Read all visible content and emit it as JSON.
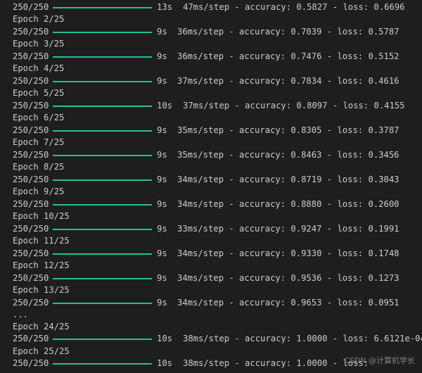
{
  "log": [
    {
      "type": "progress",
      "steps": "250/250",
      "progress": 1.0,
      "time": "13s",
      "metrics": "47ms/step - accuracy: 0.5827 - loss: 0.6696"
    },
    {
      "type": "text",
      "text": "Epoch 2/25"
    },
    {
      "type": "progress",
      "steps": "250/250",
      "progress": 1.0,
      "time": "9s",
      "metrics": "36ms/step - accuracy: 0.7039 - loss: 0.5787"
    },
    {
      "type": "text",
      "text": "Epoch 3/25"
    },
    {
      "type": "progress",
      "steps": "250/250",
      "progress": 1.0,
      "time": "9s",
      "metrics": "36ms/step - accuracy: 0.7476 - loss: 0.5152"
    },
    {
      "type": "text",
      "text": "Epoch 4/25"
    },
    {
      "type": "progress",
      "steps": "250/250",
      "progress": 1.0,
      "time": "9s",
      "metrics": "37ms/step - accuracy: 0.7834 - loss: 0.4616"
    },
    {
      "type": "text",
      "text": "Epoch 5/25"
    },
    {
      "type": "progress",
      "steps": "250/250",
      "progress": 1.0,
      "time": "10s",
      "metrics": "37ms/step - accuracy: 0.8097 - loss: 0.4155"
    },
    {
      "type": "text",
      "text": "Epoch 6/25"
    },
    {
      "type": "progress",
      "steps": "250/250",
      "progress": 1.0,
      "time": "9s",
      "metrics": "35ms/step - accuracy: 0.8305 - loss: 0.3787"
    },
    {
      "type": "text",
      "text": "Epoch 7/25"
    },
    {
      "type": "progress",
      "steps": "250/250",
      "progress": 1.0,
      "time": "9s",
      "metrics": "35ms/step - accuracy: 0.8463 - loss: 0.3456"
    },
    {
      "type": "text",
      "text": "Epoch 8/25"
    },
    {
      "type": "progress",
      "steps": "250/250",
      "progress": 1.0,
      "time": "9s",
      "metrics": "34ms/step - accuracy: 0.8719 - loss: 0.3043"
    },
    {
      "type": "text",
      "text": "Epoch 9/25"
    },
    {
      "type": "progress",
      "steps": "250/250",
      "progress": 1.0,
      "time": "9s",
      "metrics": "34ms/step - accuracy: 0.8880 - loss: 0.2600"
    },
    {
      "type": "text",
      "text": "Epoch 10/25"
    },
    {
      "type": "progress",
      "steps": "250/250",
      "progress": 1.0,
      "time": "9s",
      "metrics": "33ms/step - accuracy: 0.9247 - loss: 0.1991"
    },
    {
      "type": "text",
      "text": "Epoch 11/25"
    },
    {
      "type": "progress",
      "steps": "250/250",
      "progress": 1.0,
      "time": "9s",
      "metrics": "34ms/step - accuracy: 0.9330 - loss: 0.1748"
    },
    {
      "type": "text",
      "text": "Epoch 12/25"
    },
    {
      "type": "progress",
      "steps": "250/250",
      "progress": 1.0,
      "time": "9s",
      "metrics": "34ms/step - accuracy: 0.9536 - loss: 0.1273"
    },
    {
      "type": "text",
      "text": "Epoch 13/25"
    },
    {
      "type": "progress",
      "steps": "250/250",
      "progress": 1.0,
      "time": "9s",
      "metrics": "34ms/step - accuracy: 0.9653 - loss: 0.0951"
    },
    {
      "type": "text",
      "text": "..."
    },
    {
      "type": "text",
      "text": "Epoch 24/25"
    },
    {
      "type": "progress",
      "steps": "250/250",
      "progress": 1.0,
      "time": "10s",
      "metrics": "38ms/step - accuracy: 1.0000 - loss: 6.6121e-04"
    },
    {
      "type": "text",
      "text": "Epoch 25/25"
    },
    {
      "type": "progress",
      "steps": "250/250",
      "progress": 1.0,
      "time": "10s",
      "metrics": "38ms/step - accuracy: 1.0000 - loss:"
    }
  ],
  "watermark": "CSDN @计算机学长",
  "colors": {
    "background": "#1e1e1e",
    "text": "#cccccc",
    "progress_bar": "#23c09a"
  }
}
